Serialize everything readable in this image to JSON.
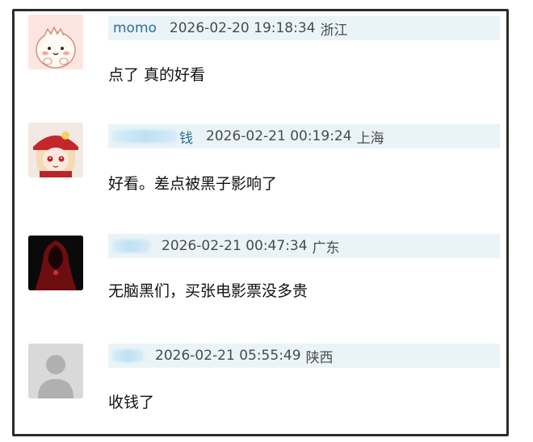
{
  "comments": [
    {
      "username": "momo",
      "timestamp": "2026-02-20 19:18:34",
      "location": "浙江",
      "text": "点了 真的好看",
      "avatar": "chibi-creature-icon"
    },
    {
      "username_visible_fragment": "钱",
      "timestamp": "2026-02-21 00:19:24",
      "location": "上海",
      "text": "好看。差点被黑子影响了",
      "avatar": "anime-girl-red-hat-icon"
    },
    {
      "timestamp": "2026-02-21 00:47:34",
      "location": "广东",
      "text": "无脑黑们，买张电影票没多贵",
      "avatar": "red-hooded-figure-icon"
    },
    {
      "timestamp": "2026-02-21 05:55:49",
      "location": "陕西",
      "text": "收钱了",
      "avatar": "default-user-icon"
    }
  ],
  "colors": {
    "meta_bar": "#eaf4f8",
    "username": "#2c6f96",
    "frame_border": "#2b2b2b"
  }
}
